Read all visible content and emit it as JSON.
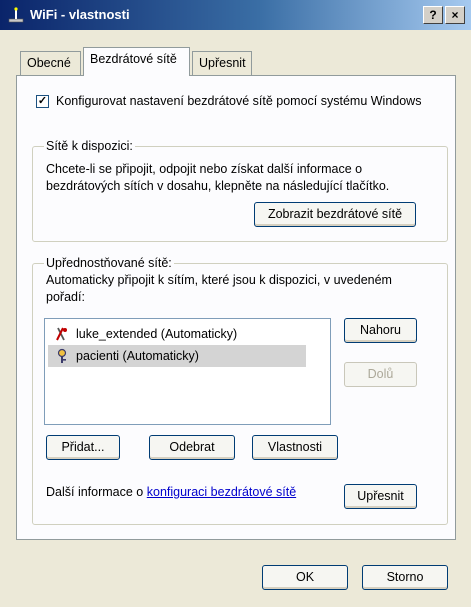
{
  "window": {
    "title": "WiFi - vlastnosti",
    "help_label": "?",
    "close_label": "×"
  },
  "tabs": [
    {
      "label": "Obecné",
      "active": false
    },
    {
      "label": "Bezdrátové sítě",
      "active": true
    },
    {
      "label": "Upřesnit",
      "active": false
    }
  ],
  "configure_checkbox": {
    "checked": true,
    "check_glyph": "✓",
    "label": "Konfigurovat nastavení bezdrátové sítě pomocí systému Windows"
  },
  "available": {
    "legend": "Sítě k dispozici:",
    "description_line1": "Chcete-li se připojit, odpojit nebo získat další informace o",
    "description_line2": "bezdrátových sítích v dosahu, klepněte na následující tlačítko.",
    "show_button": "Zobrazit bezdrátové sítě"
  },
  "preferred": {
    "legend": "Upřednostňované sítě:",
    "description_line1": "Automaticky připojit k sítím, které jsou k dispozici, v uvedeném",
    "description_line2": "pořadí:",
    "networks": [
      {
        "name": "luke_extended (Automaticky)",
        "icon": "network-warning-icon",
        "selected": false
      },
      {
        "name": "pacienti (Automaticky)",
        "icon": "network-key-icon",
        "selected": true
      }
    ],
    "up_button": "Nahoru",
    "down_button": "Dolů",
    "add_button": "Přidat...",
    "remove_button": "Odebrat",
    "properties_button": "Vlastnosti",
    "more_info_prefix": "Další informace o",
    "more_info_link": "konfiguraci bezdrátové sítě",
    "advanced_button": "Upřesnit"
  },
  "footer": {
    "ok_button": "OK",
    "cancel_button": "Storno"
  }
}
